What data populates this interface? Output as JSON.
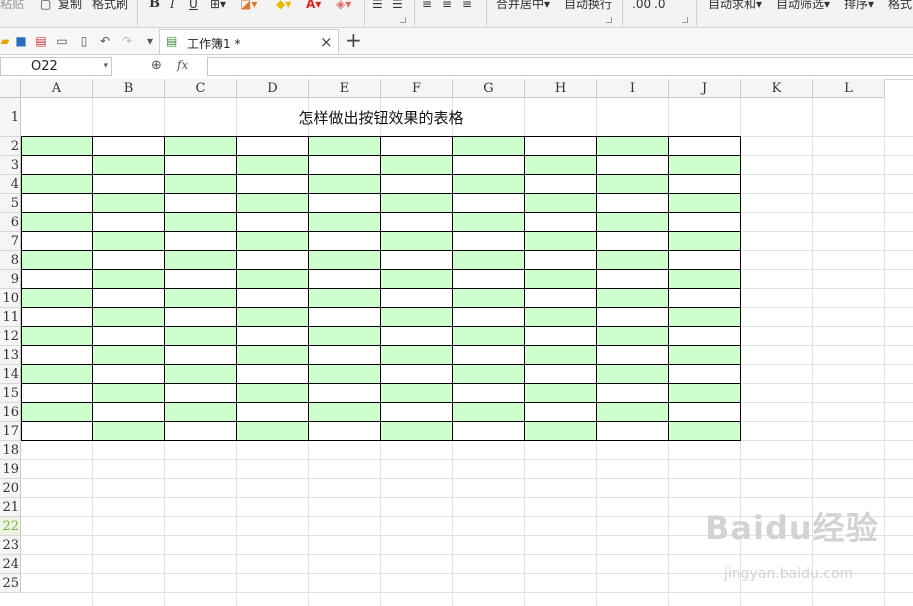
{
  "ribbon": {
    "paste": "粘贴",
    "copy": "复制",
    "format_painter": "格式刷",
    "bold": "B",
    "italic": "I",
    "underline": "U",
    "merge_center": "合并居中",
    "wrap_text": "自动换行",
    "auto_sum": "自动求和",
    "auto_filter": "自动筛选",
    "sort": "排序",
    "format": "格式"
  },
  "tab": {
    "title": "工作簿1 *",
    "close": "×",
    "new": "+"
  },
  "formula_bar": {
    "name_box": "O22",
    "fx": "fx",
    "value": ""
  },
  "columns": [
    "A",
    "B",
    "C",
    "D",
    "E",
    "F",
    "G",
    "H",
    "I",
    "J",
    "K",
    "L"
  ],
  "rows": [
    "1",
    "2",
    "3",
    "4",
    "5",
    "6",
    "7",
    "8",
    "9",
    "10",
    "11",
    "12",
    "13",
    "14",
    "15",
    "16",
    "17",
    "18",
    "19",
    "20",
    "21",
    "22",
    "23",
    "24",
    "25"
  ],
  "selected_row": "22",
  "sheet": {
    "title": "怎样做出按钮效果的表格"
  },
  "colors": {
    "green_fill": "#ccffcc",
    "selected_row_text": "#79b342"
  },
  "watermark": {
    "brand": "Baidu经验",
    "url": "jingyan.baidu.com"
  }
}
